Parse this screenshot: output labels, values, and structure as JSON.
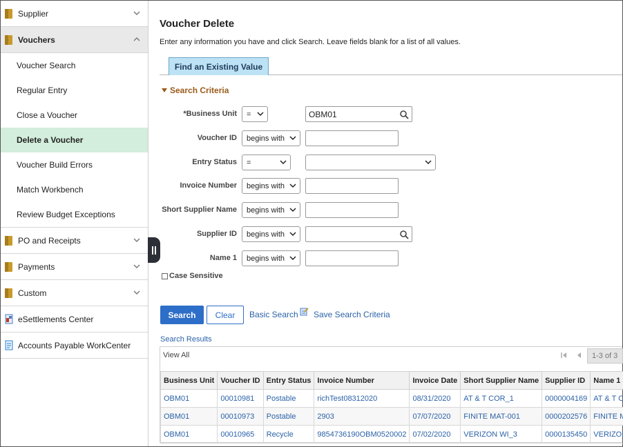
{
  "sidebar": {
    "groups_top": [
      {
        "label": "Supplier"
      },
      {
        "label": "Vouchers"
      }
    ],
    "voucher_items": [
      {
        "label": "Voucher Search"
      },
      {
        "label": "Regular Entry"
      },
      {
        "label": "Close a Voucher"
      },
      {
        "label": "Delete a Voucher"
      },
      {
        "label": "Voucher Build Errors"
      },
      {
        "label": "Match Workbench"
      },
      {
        "label": "Review Budget Exceptions"
      }
    ],
    "groups_bottom": [
      {
        "label": "PO and Receipts"
      },
      {
        "label": "Payments"
      },
      {
        "label": "Custom"
      }
    ],
    "apps": [
      {
        "label": "eSettlements Center"
      },
      {
        "label": "Accounts Payable WorkCenter"
      }
    ]
  },
  "page": {
    "title": "Voucher Delete",
    "instructions": "Enter any information you have and click Search. Leave fields blank for a list of all values.",
    "tab": "Find an Existing Value",
    "criteria_title": "Search Criteria"
  },
  "criteria": [
    {
      "label": "*Business Unit",
      "operator": "=",
      "value": "OBM01"
    },
    {
      "label": "Voucher ID",
      "operator": "begins with",
      "value": ""
    },
    {
      "label": "Entry Status",
      "operator": "=",
      "value": ""
    },
    {
      "label": "Invoice Number",
      "operator": "begins with",
      "value": ""
    },
    {
      "label": "Short Supplier Name",
      "operator": "begins with",
      "value": ""
    },
    {
      "label": "Supplier ID",
      "operator": "begins with",
      "value": ""
    },
    {
      "label": "Name 1",
      "operator": "begins with",
      "value": ""
    }
  ],
  "case_sensitive_label": "Case Sensitive",
  "actions": {
    "search": "Search",
    "clear": "Clear",
    "basic_search": "Basic Search",
    "save_criteria": "Save Search Criteria"
  },
  "results": {
    "title": "Search Results",
    "view_all": "View All",
    "pager": "1-3 of 3",
    "columns": [
      "Business Unit",
      "Voucher ID",
      "Entry Status",
      "Invoice Number",
      "Invoice Date",
      "Short Supplier Name",
      "Supplier ID",
      "Name 1"
    ],
    "rows": [
      [
        "OBM01",
        "00010981",
        "Postable",
        "richTest08312020",
        "08/31/2020",
        "AT & T COR_1",
        "0000004169",
        "AT & T COR"
      ],
      [
        "OBM01",
        "00010973",
        "Postable",
        "2903",
        "07/07/2020",
        "FINITE MAT-001",
        "0000202576",
        "FINITE MAT"
      ],
      [
        "OBM01",
        "00010965",
        "Recycle",
        "9854736190OBM0520002",
        "07/02/2020",
        "VERIZON WI_3",
        "0000135450",
        "VERIZON WI"
      ]
    ]
  }
}
